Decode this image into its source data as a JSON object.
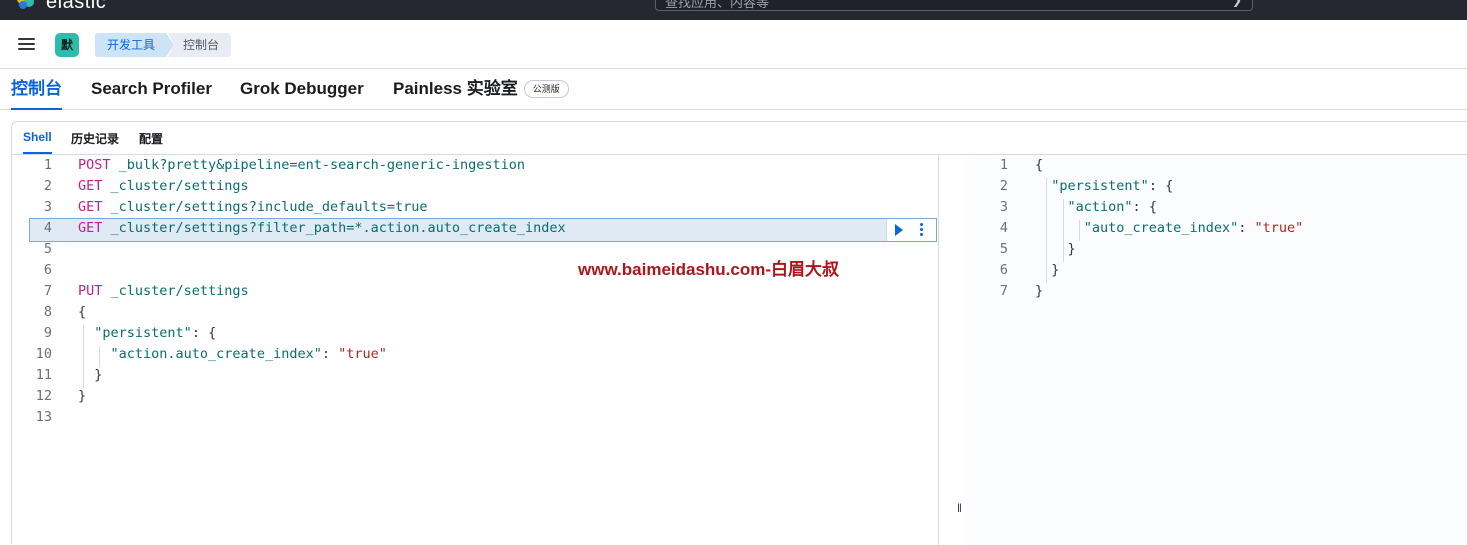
{
  "header": {
    "brand": "elastic",
    "search_placeholder": "查找应用、内容等",
    "search_shortcut_icon": "chevron-icon"
  },
  "breadcrumbs": {
    "space_initial": "默",
    "items": [
      "开发工具",
      "控制台"
    ]
  },
  "tool_tabs": [
    {
      "label": "控制台",
      "active": true
    },
    {
      "label": "Search Profiler",
      "active": false
    },
    {
      "label": "Grok Debugger",
      "active": false
    },
    {
      "label": "Painless 实验室",
      "badge": "公测版",
      "active": false
    }
  ],
  "sub_tabs": [
    {
      "label": "Shell",
      "active": true
    },
    {
      "label": "历史记录",
      "active": false
    },
    {
      "label": "配置",
      "active": false
    }
  ],
  "editor": {
    "lines": [
      {
        "n": "1",
        "method": "POST",
        "rest": " _bulk?pretty&pipeline=ent-search-generic-ingestion"
      },
      {
        "n": "2",
        "method": "GET",
        "rest": " _cluster/settings"
      },
      {
        "n": "3",
        "method": "GET",
        "rest": " _cluster/settings?include_defaults=true"
      },
      {
        "n": "4",
        "method": "GET",
        "rest": " _cluster/settings?filter_path=*.action.auto_create_index"
      },
      {
        "n": "5",
        "method": "",
        "rest": ""
      },
      {
        "n": "6",
        "method": "",
        "rest": ""
      },
      {
        "n": "7",
        "method": "PUT",
        "rest": " _cluster/settings"
      },
      {
        "n": "8",
        "method": "",
        "rest": "{"
      },
      {
        "n": "9",
        "method": "",
        "rest": "  \"persistent\": {"
      },
      {
        "n": "10",
        "method": "",
        "rest": "    \"action.auto_create_index\": \"true\""
      },
      {
        "n": "11",
        "method": "",
        "rest": "  }"
      },
      {
        "n": "12",
        "method": "",
        "rest": "}"
      },
      {
        "n": "13",
        "method": "",
        "rest": ""
      }
    ],
    "selected_line": "4",
    "run_icon": "play-icon",
    "options_icon": "kebab-icon"
  },
  "watermark": "www.baimeidashu.com-白眉大叔",
  "output": {
    "lines": [
      {
        "n": "1",
        "text": "{"
      },
      {
        "n": "2",
        "text": "  \"persistent\": {"
      },
      {
        "n": "3",
        "text": "    \"action\": {"
      },
      {
        "n": "4",
        "text": "      \"auto_create_index\": \"true\""
      },
      {
        "n": "5",
        "text": "    }"
      },
      {
        "n": "6",
        "text": "  }"
      },
      {
        "n": "7",
        "text": "}"
      }
    ]
  },
  "colors": {
    "accent": "#0b64dd",
    "method": "#c61e8f",
    "key": "#0a6e6e",
    "string": "#b3261e",
    "watermark": "#b0141b"
  }
}
